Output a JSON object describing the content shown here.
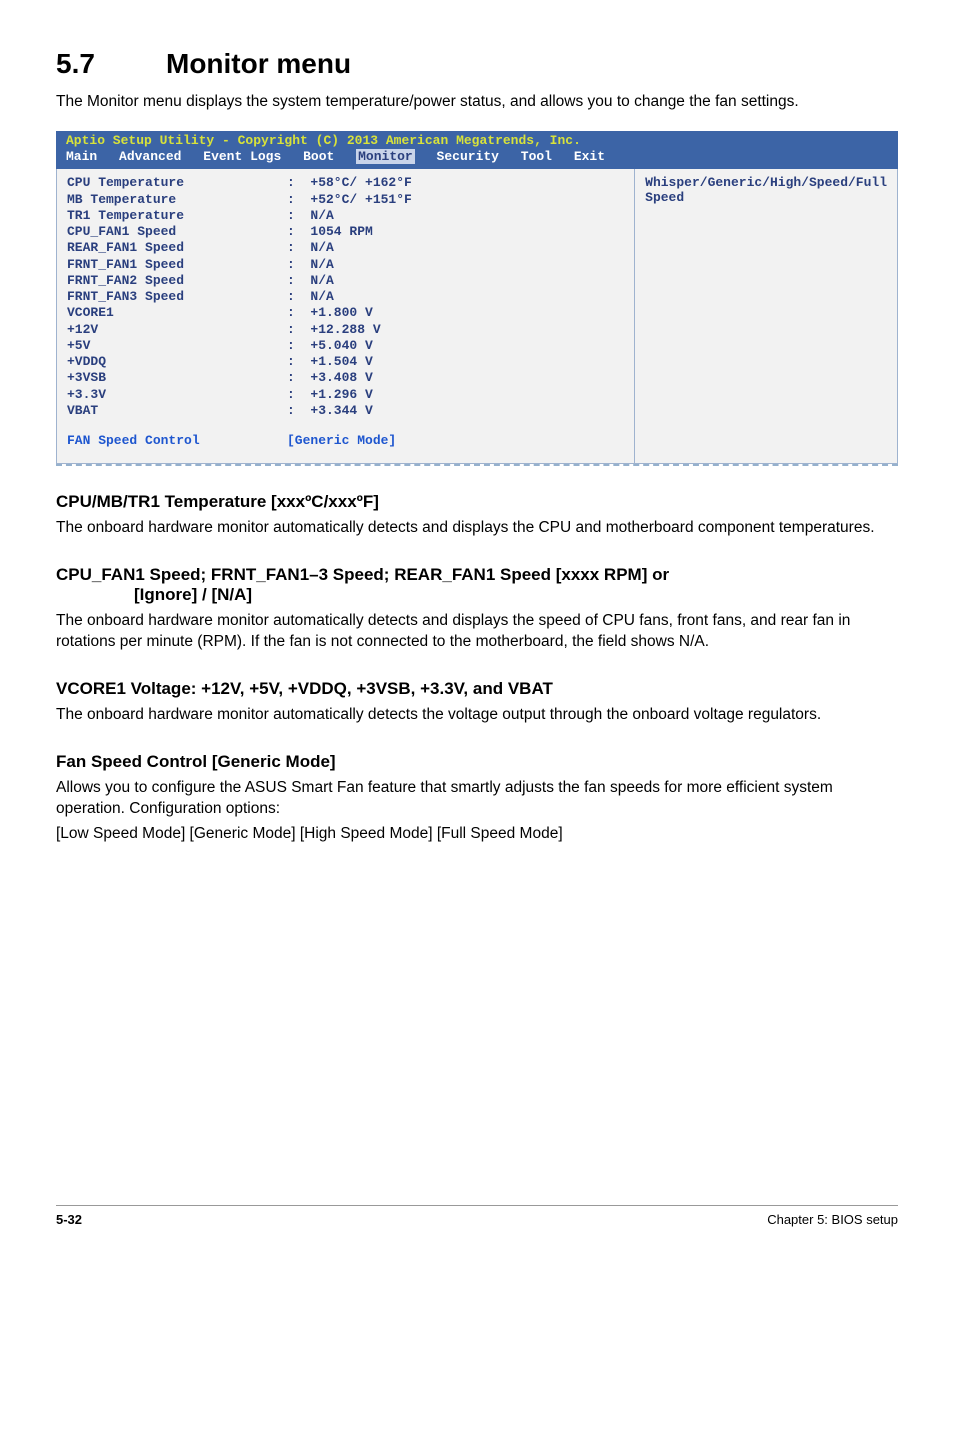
{
  "heading": {
    "number": "5.7",
    "title": "Monitor menu"
  },
  "intro": "The Monitor menu displays the system temperature/power status, and allows you to change the fan settings.",
  "bios": {
    "title": "Aptio Setup Utility - Copyright (C) 2013 American Megatrends, Inc.",
    "menu": [
      "Main",
      "Advanced",
      "Event Logs",
      "Boot",
      "Monitor",
      "Security",
      "Tool",
      "Exit"
    ],
    "active": "Monitor",
    "rows": [
      {
        "k": "CPU Temperature",
        "v": ":  +58°C/ +162°F"
      },
      {
        "k": "MB Temperature",
        "v": ":  +52°C/ +151°F"
      },
      {
        "k": "TR1 Temperature",
        "v": ":  N/A"
      },
      {
        "k": "CPU_FAN1 Speed",
        "v": ":  1054 RPM"
      },
      {
        "k": "REAR_FAN1 Speed",
        "v": ":  N/A"
      },
      {
        "k": "FRNT_FAN1 Speed",
        "v": ":  N/A"
      },
      {
        "k": "FRNT_FAN2 Speed",
        "v": ":  N/A"
      },
      {
        "k": "FRNT_FAN3 Speed",
        "v": ":  N/A"
      },
      {
        "k": "VCORE1",
        "v": ":  +1.800 V"
      },
      {
        "k": "+12V",
        "v": ":  +12.288 V"
      },
      {
        "k": "+5V",
        "v": ":  +5.040 V"
      },
      {
        "k": "+VDDQ",
        "v": ":  +1.504 V"
      },
      {
        "k": "+3VSB",
        "v": ":  +3.408 V"
      },
      {
        "k": "+3.3V",
        "v": ":  +1.296 V"
      },
      {
        "k": "VBAT",
        "v": ":  +3.344 V"
      }
    ],
    "fan_speed": {
      "label": "FAN Speed Control",
      "value": "[Generic Mode]"
    },
    "help": "Whisper/Generic/High/Speed/Full Speed"
  },
  "sections": {
    "s1": {
      "title": "CPU/MB/TR1 Temperature [xxxºC/xxxºF]",
      "body": "The onboard hardware monitor automatically detects and displays the CPU and motherboard component temperatures."
    },
    "s2": {
      "title_line1": "CPU_FAN1 Speed; FRNT_FAN1–3 Speed; REAR_FAN1 Speed [xxxx RPM] or",
      "title_line2": "[Ignore] / [N/A]",
      "body": "The onboard hardware monitor automatically detects and displays the speed of CPU fans, front fans, and rear fan in rotations per minute (RPM). If the fan is not connected to the motherboard, the field shows N/A."
    },
    "s3": {
      "title": "VCORE1 Voltage: +12V, +5V, +VDDQ, +3VSB, +3.3V, and VBAT",
      "body": "The onboard hardware monitor automatically detects the voltage output through the onboard voltage regulators."
    },
    "s4": {
      "title": "Fan Speed Control [Generic Mode]",
      "body1": "Allows you to configure the ASUS Smart Fan feature that smartly adjusts the fan speeds for more efficient system operation. Configuration options:",
      "body2": "[Low Speed Mode] [Generic Mode] [High Speed Mode] [Full Speed Mode]"
    }
  },
  "footer": {
    "page": "5-32",
    "chapter": "Chapter 5: BIOS setup"
  }
}
